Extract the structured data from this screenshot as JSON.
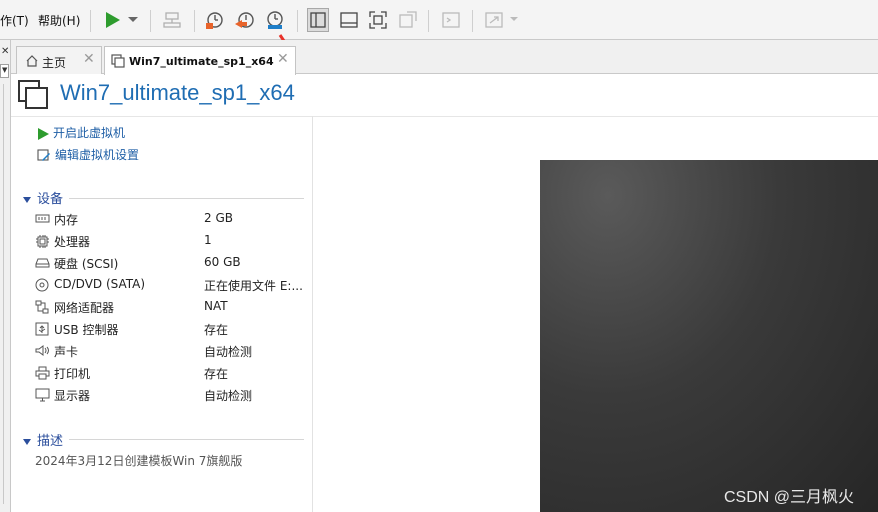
{
  "menubar": {
    "edit_partial": "作(T)",
    "help": "帮助(H)"
  },
  "tabs": [
    {
      "label": "主页"
    },
    {
      "label": "Win7_ultimate_sp1_x64"
    }
  ],
  "vm": {
    "title": "Win7_ultimate_sp1_x64"
  },
  "actions": {
    "power_on": "开启此虚拟机",
    "edit_settings": "编辑虚拟机设置"
  },
  "devices": {
    "heading": "设备",
    "rows": [
      {
        "name": "内存",
        "value": "2 GB",
        "icon": "memory-icon"
      },
      {
        "name": "处理器",
        "value": "1",
        "icon": "processor-icon"
      },
      {
        "name": "硬盘 (SCSI)",
        "value": "60 GB",
        "icon": "hard-disk-icon"
      },
      {
        "name": "CD/DVD (SATA)",
        "value": "正在使用文件 E:...",
        "icon": "cd-dvd-icon"
      },
      {
        "name": "网络适配器",
        "value": "NAT",
        "icon": "network-adapter-icon"
      },
      {
        "name": "USB 控制器",
        "value": "存在",
        "icon": "usb-icon"
      },
      {
        "name": "声卡",
        "value": "自动检测",
        "icon": "sound-card-icon"
      },
      {
        "name": "打印机",
        "value": "存在",
        "icon": "printer-icon"
      },
      {
        "name": "显示器",
        "value": "自动检测",
        "icon": "display-icon"
      }
    ]
  },
  "description": {
    "heading": "描述",
    "text": "2024年3月12日创建模板Win 7旗舰版"
  },
  "watermark": "CSDN @三月枫火",
  "colors": {
    "accent": "#1f6db3",
    "play_green": "#2e9c2e",
    "snapshot_orange": "#e8632a",
    "snapshot_blue": "#1e7ec8",
    "arrow_red": "#e8322a"
  }
}
